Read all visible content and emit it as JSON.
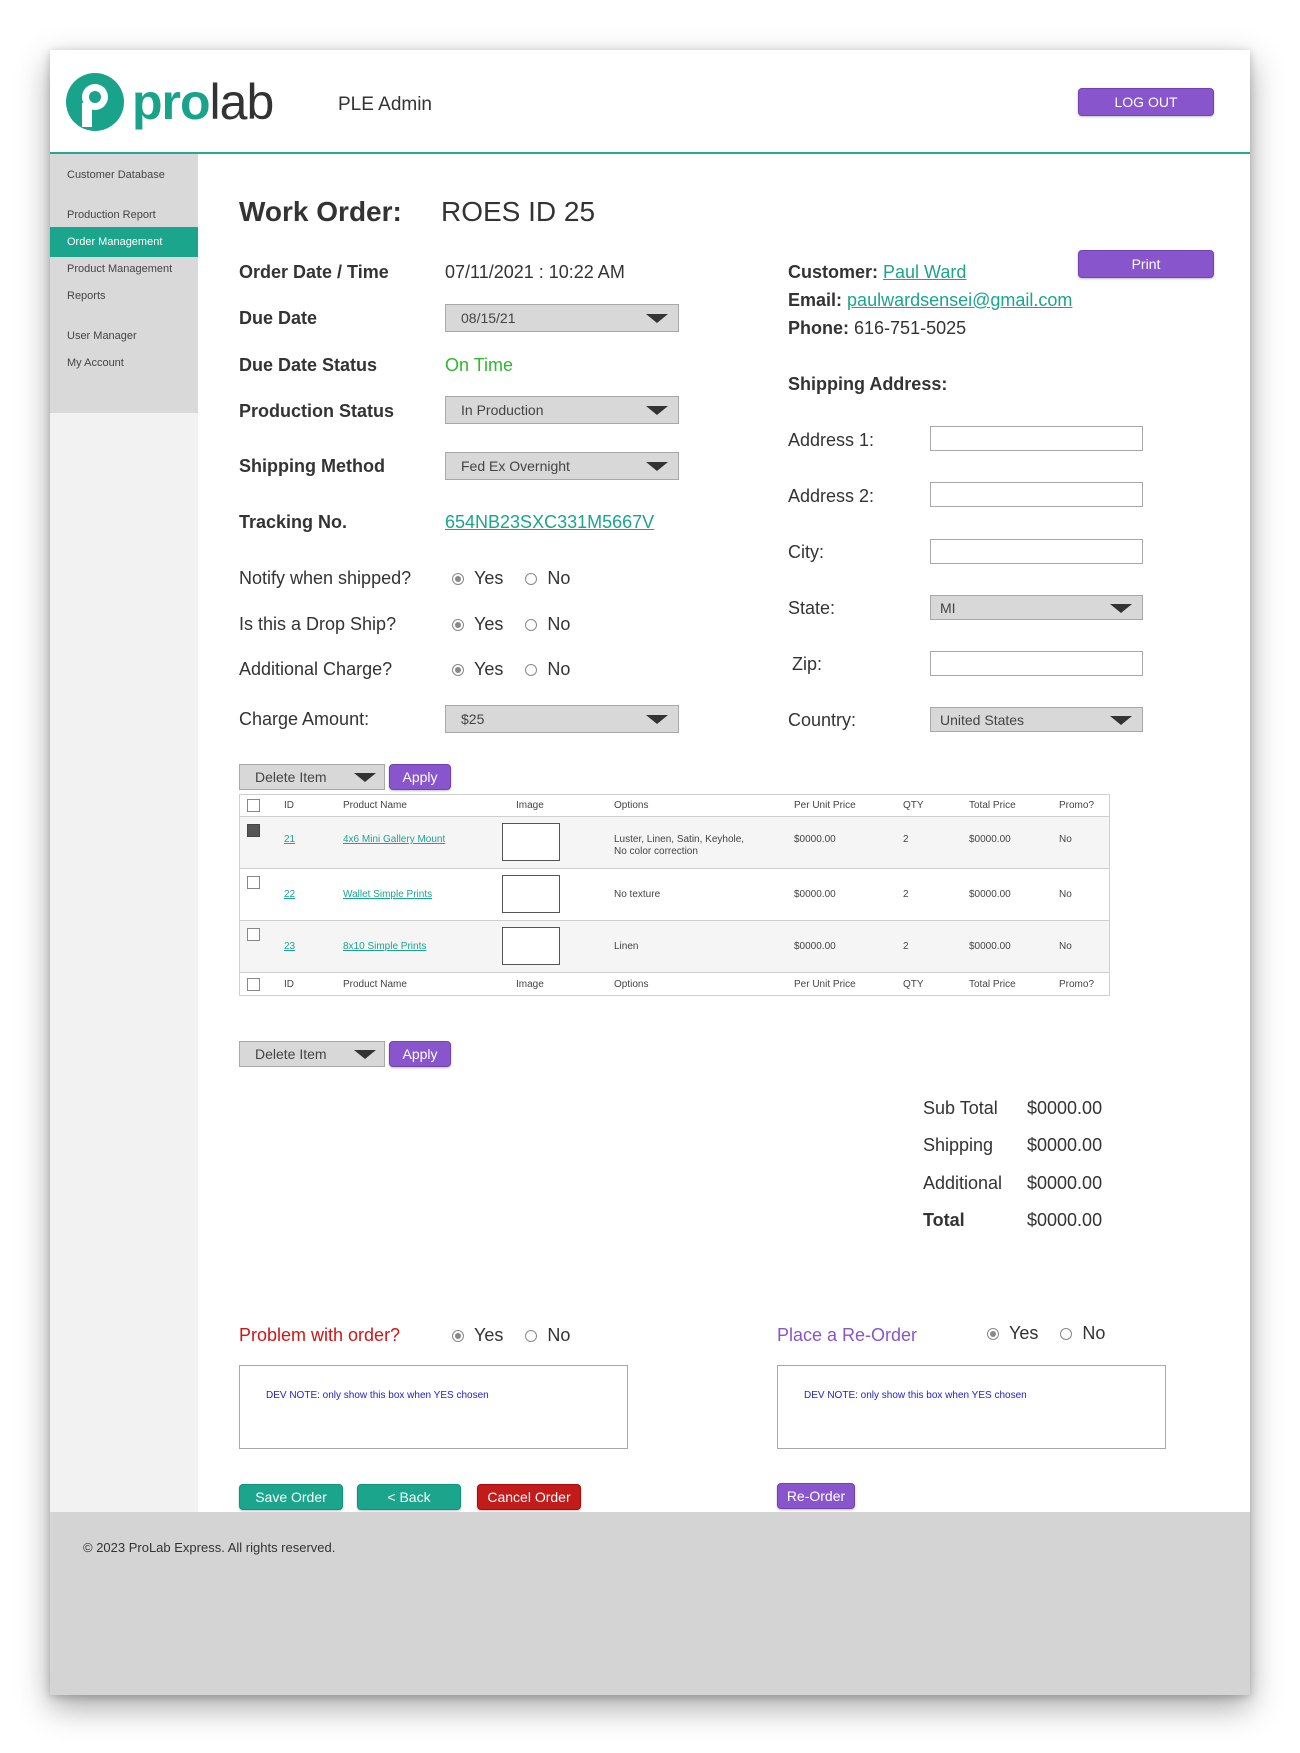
{
  "header": {
    "logo_pro": "pro",
    "logo_lab": "lab",
    "app_name": "PLE Admin",
    "logout_label": "LOG OUT"
  },
  "sidebar": {
    "items": [
      {
        "label": "Customer Database"
      },
      {
        "label": "Production Report"
      },
      {
        "label": "Order Management",
        "active": true
      },
      {
        "label": "Product Management"
      },
      {
        "label": "Reports"
      },
      {
        "label": "User Manager"
      },
      {
        "label": "My Account"
      }
    ]
  },
  "work_order": {
    "title_label": "Work Order:",
    "title_value": "ROES ID 25",
    "print_label": "Print",
    "order_date_label": "Order Date / Time",
    "order_date_value": "07/11/2021 : 10:22 AM",
    "due_date_label": "Due Date",
    "due_date_value": "08/15/21",
    "due_status_label": "Due Date Status",
    "due_status_value": "On Time",
    "production_status_label": "Production Status",
    "production_status_value": "In Production",
    "shipping_method_label": "Shipping Method",
    "shipping_method_value": "Fed Ex Overnight",
    "tracking_label": "Tracking No.",
    "tracking_value": "654NB23SXC331M5667V",
    "notify_label": "Notify when shipped?",
    "drop_ship_label": "Is this a Drop Ship?",
    "additional_charge_label": "Additional Charge?",
    "charge_amount_label": "Charge Amount:",
    "charge_amount_value": "$25",
    "yes_label": "Yes",
    "no_label": "No"
  },
  "customer": {
    "customer_label": "Customer:",
    "customer_name": "Paul Ward",
    "email_label": "Email:",
    "email_value": "paulwardsensei@gmail.com",
    "phone_label": "Phone:",
    "phone_value": "616-751-5025",
    "shipping_address_label": "Shipping Address:",
    "address1_label": "Address 1:",
    "address2_label": "Address 2:",
    "city_label": "City:",
    "state_label": "State:",
    "state_value": "MI",
    "zip_label": "Zip:",
    "country_label": "Country:",
    "country_value": "United States"
  },
  "bulk": {
    "action_value": "Delete Item",
    "apply_label": "Apply"
  },
  "table": {
    "columns": [
      "ID",
      "Product Name",
      "Image",
      "Options",
      "Per Unit Price",
      "QTY",
      "Total Price",
      "Promo?"
    ],
    "rows": [
      {
        "id": "21",
        "name": "4x6 Mini Gallery Mount",
        "options_1": "Luster, Linen, Satin, Keyhole,",
        "options_2": "No color correction",
        "unit_price": "$0000.00",
        "qty": "2",
        "total": "$0000.00",
        "promo": "No",
        "checked": true
      },
      {
        "id": "22",
        "name": "Wallet Simple Prints",
        "options_1": "No texture",
        "options_2": "",
        "unit_price": "$0000.00",
        "qty": "2",
        "total": "$0000.00",
        "promo": "No",
        "checked": false
      },
      {
        "id": "23",
        "name": "8x10 Simple Prints",
        "options_1": "Linen",
        "options_2": "",
        "unit_price": "$0000.00",
        "qty": "2",
        "total": "$0000.00",
        "promo": "No",
        "checked": false
      }
    ]
  },
  "totals": {
    "subtotal_label": "Sub Total",
    "subtotal_value": "$0000.00",
    "shipping_label": "Shipping",
    "shipping_value": "$0000.00",
    "additional_label": "Additional",
    "additional_value": "$0000.00",
    "total_label": "Total",
    "total_value": "$0000.00"
  },
  "problem": {
    "label": "Problem with order?",
    "note": "DEV NOTE: only show this box when YES chosen"
  },
  "reorder": {
    "label": "Place a Re-Order",
    "note": "DEV NOTE: only show this box when YES chosen",
    "button_label": "Re-Order"
  },
  "actions": {
    "save_label": "Save Order",
    "back_label": "< Back",
    "cancel_label": "Cancel Order"
  },
  "footer": {
    "copyright": "© 2023 ProLab Express. All rights reserved."
  },
  "colors": {
    "brand_teal": "#1aa58c",
    "accent_purple": "#8855cc",
    "danger_red": "#c31a1a",
    "status_green": "#2db82d"
  }
}
